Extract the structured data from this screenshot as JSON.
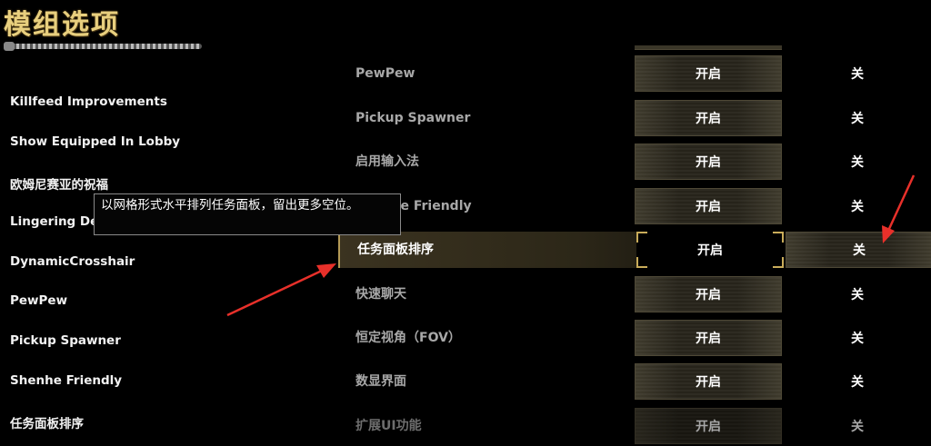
{
  "header": {
    "title": "模组选项"
  },
  "left_list": {
    "items": [
      "Killfeed Improvements",
      "Show Equipped In Lobby",
      "欧姆尼赛亚的祝福",
      "Lingering De",
      "DynamicCrosshair",
      "PewPew",
      "Pickup Spawner",
      "Shenhe Friendly",
      "任务面板排序"
    ]
  },
  "tooltip": {
    "text": "以网格形式水平排列任务面板，留出更多空位。"
  },
  "options": {
    "on_label": "开启",
    "off_label": "关",
    "rows": [
      {
        "label": "PewPew"
      },
      {
        "label": "Pickup Spawner"
      },
      {
        "label": "启用输入法"
      },
      {
        "label": "Shenhe Friendly"
      },
      {
        "label": "任务面板排序"
      },
      {
        "label": "快速聊天"
      },
      {
        "label": "恒定视角（FOV）"
      },
      {
        "label": "数显界面"
      },
      {
        "label": "扩展UI功能"
      }
    ]
  },
  "colors": {
    "accent_gold": "#c9ac5a",
    "arrow_red": "#e8302a"
  }
}
